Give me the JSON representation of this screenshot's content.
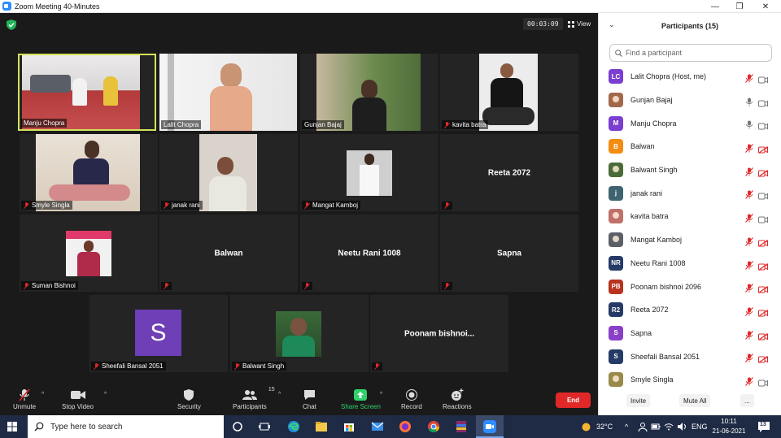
{
  "window": {
    "title": "Zoom Meeting 40-Minutes",
    "controls": {
      "minimize": "—",
      "restore": "❐",
      "close": "✕"
    }
  },
  "meeting": {
    "timer": "00:03:09",
    "view_label": "View",
    "tiles": [
      {
        "name": "Manju Chopra",
        "muted": false,
        "kind": "video",
        "active": true
      },
      {
        "name": "Lalit Chopra",
        "muted": false,
        "kind": "video"
      },
      {
        "name": "Gunjan Bajaj",
        "muted": false,
        "kind": "video"
      },
      {
        "name": "kavita batra",
        "muted": true,
        "kind": "video"
      },
      {
        "name": "Smyle Singla",
        "muted": true,
        "kind": "video"
      },
      {
        "name": "janak rani",
        "muted": true,
        "kind": "video"
      },
      {
        "name": "Mangat Kamboj",
        "muted": true,
        "kind": "video"
      },
      {
        "name": "Reeta 2072",
        "muted": true,
        "kind": "name"
      },
      {
        "name": "Suman Bishnoi",
        "muted": true,
        "kind": "video"
      },
      {
        "name": "Balwan",
        "muted": true,
        "kind": "name"
      },
      {
        "name": "Neetu Rani 1008",
        "muted": true,
        "kind": "name"
      },
      {
        "name": "Sapna",
        "muted": true,
        "kind": "name"
      },
      {
        "name": "Sheefali Bansal 2051",
        "muted": true,
        "kind": "avatar",
        "initial": "S"
      },
      {
        "name": "Balwant Singh",
        "muted": true,
        "kind": "video"
      },
      {
        "name": "Poonam  bishnoi...",
        "muted": true,
        "kind": "name"
      }
    ]
  },
  "toolbar": {
    "unmute": "Unmute",
    "stop_video": "Stop Video",
    "security": "Security",
    "participants": "Participants",
    "participants_count": "15",
    "chat": "Chat",
    "share_screen": "Share Screen",
    "record": "Record",
    "reactions": "Reactions",
    "end": "End"
  },
  "panel": {
    "title": "Participants (15)",
    "search_placeholder": "Find a participant",
    "participants": [
      {
        "initials": "LC",
        "name": "Lalit Chopra (Host, me)",
        "color": "#7a3fd0",
        "photo": false,
        "mic": "off",
        "cam": "on"
      },
      {
        "initials": "",
        "name": "Gunjan Bajaj",
        "color": "#a2684a",
        "photo": true,
        "mic": "on",
        "cam": "on"
      },
      {
        "initials": "M",
        "name": "Manju Chopra",
        "color": "#7a3fd0",
        "photo": false,
        "mic": "on",
        "cam": "on"
      },
      {
        "initials": "B",
        "name": "Balwan",
        "color": "#f28c12",
        "photo": false,
        "mic": "off",
        "cam": "off"
      },
      {
        "initials": "",
        "name": "Balwant Singh",
        "color": "#4b6b3a",
        "photo": true,
        "mic": "off",
        "cam": "off"
      },
      {
        "initials": "j",
        "name": "janak rani",
        "color": "#3d6470",
        "photo": false,
        "mic": "off",
        "cam": "on"
      },
      {
        "initials": "",
        "name": "kavita batra",
        "color": "#c0706a",
        "photo": true,
        "mic": "off",
        "cam": "on"
      },
      {
        "initials": "",
        "name": "Mangat Kamboj",
        "color": "#5b5f66",
        "photo": true,
        "mic": "off",
        "cam": "off"
      },
      {
        "initials": "NR",
        "name": "Neetu Rani 1008",
        "color": "#253a66",
        "photo": false,
        "mic": "off",
        "cam": "off"
      },
      {
        "initials": "PB",
        "name": "Poonam bishnoi 2096",
        "color": "#b8321f",
        "photo": false,
        "mic": "off",
        "cam": "off"
      },
      {
        "initials": "R2",
        "name": "Reeta 2072",
        "color": "#253a66",
        "photo": false,
        "mic": "off",
        "cam": "off"
      },
      {
        "initials": "S",
        "name": "Sapna",
        "color": "#8a3fc8",
        "photo": false,
        "mic": "off",
        "cam": "off"
      },
      {
        "initials": "S",
        "name": "Sheefali Bansal 2051",
        "color": "#253a66",
        "photo": false,
        "mic": "off",
        "cam": "off"
      },
      {
        "initials": "",
        "name": "Smyle Singla",
        "color": "#9a8a4a",
        "photo": true,
        "mic": "off",
        "cam": "on"
      }
    ],
    "invite": "Invite",
    "mute_all": "Mute All",
    "more": "..."
  },
  "taskbar": {
    "search_text": "Type here to search",
    "temperature": "32°C",
    "language": "ENG",
    "time": "10:11",
    "date": "21-06-2021",
    "notifications": "13"
  }
}
